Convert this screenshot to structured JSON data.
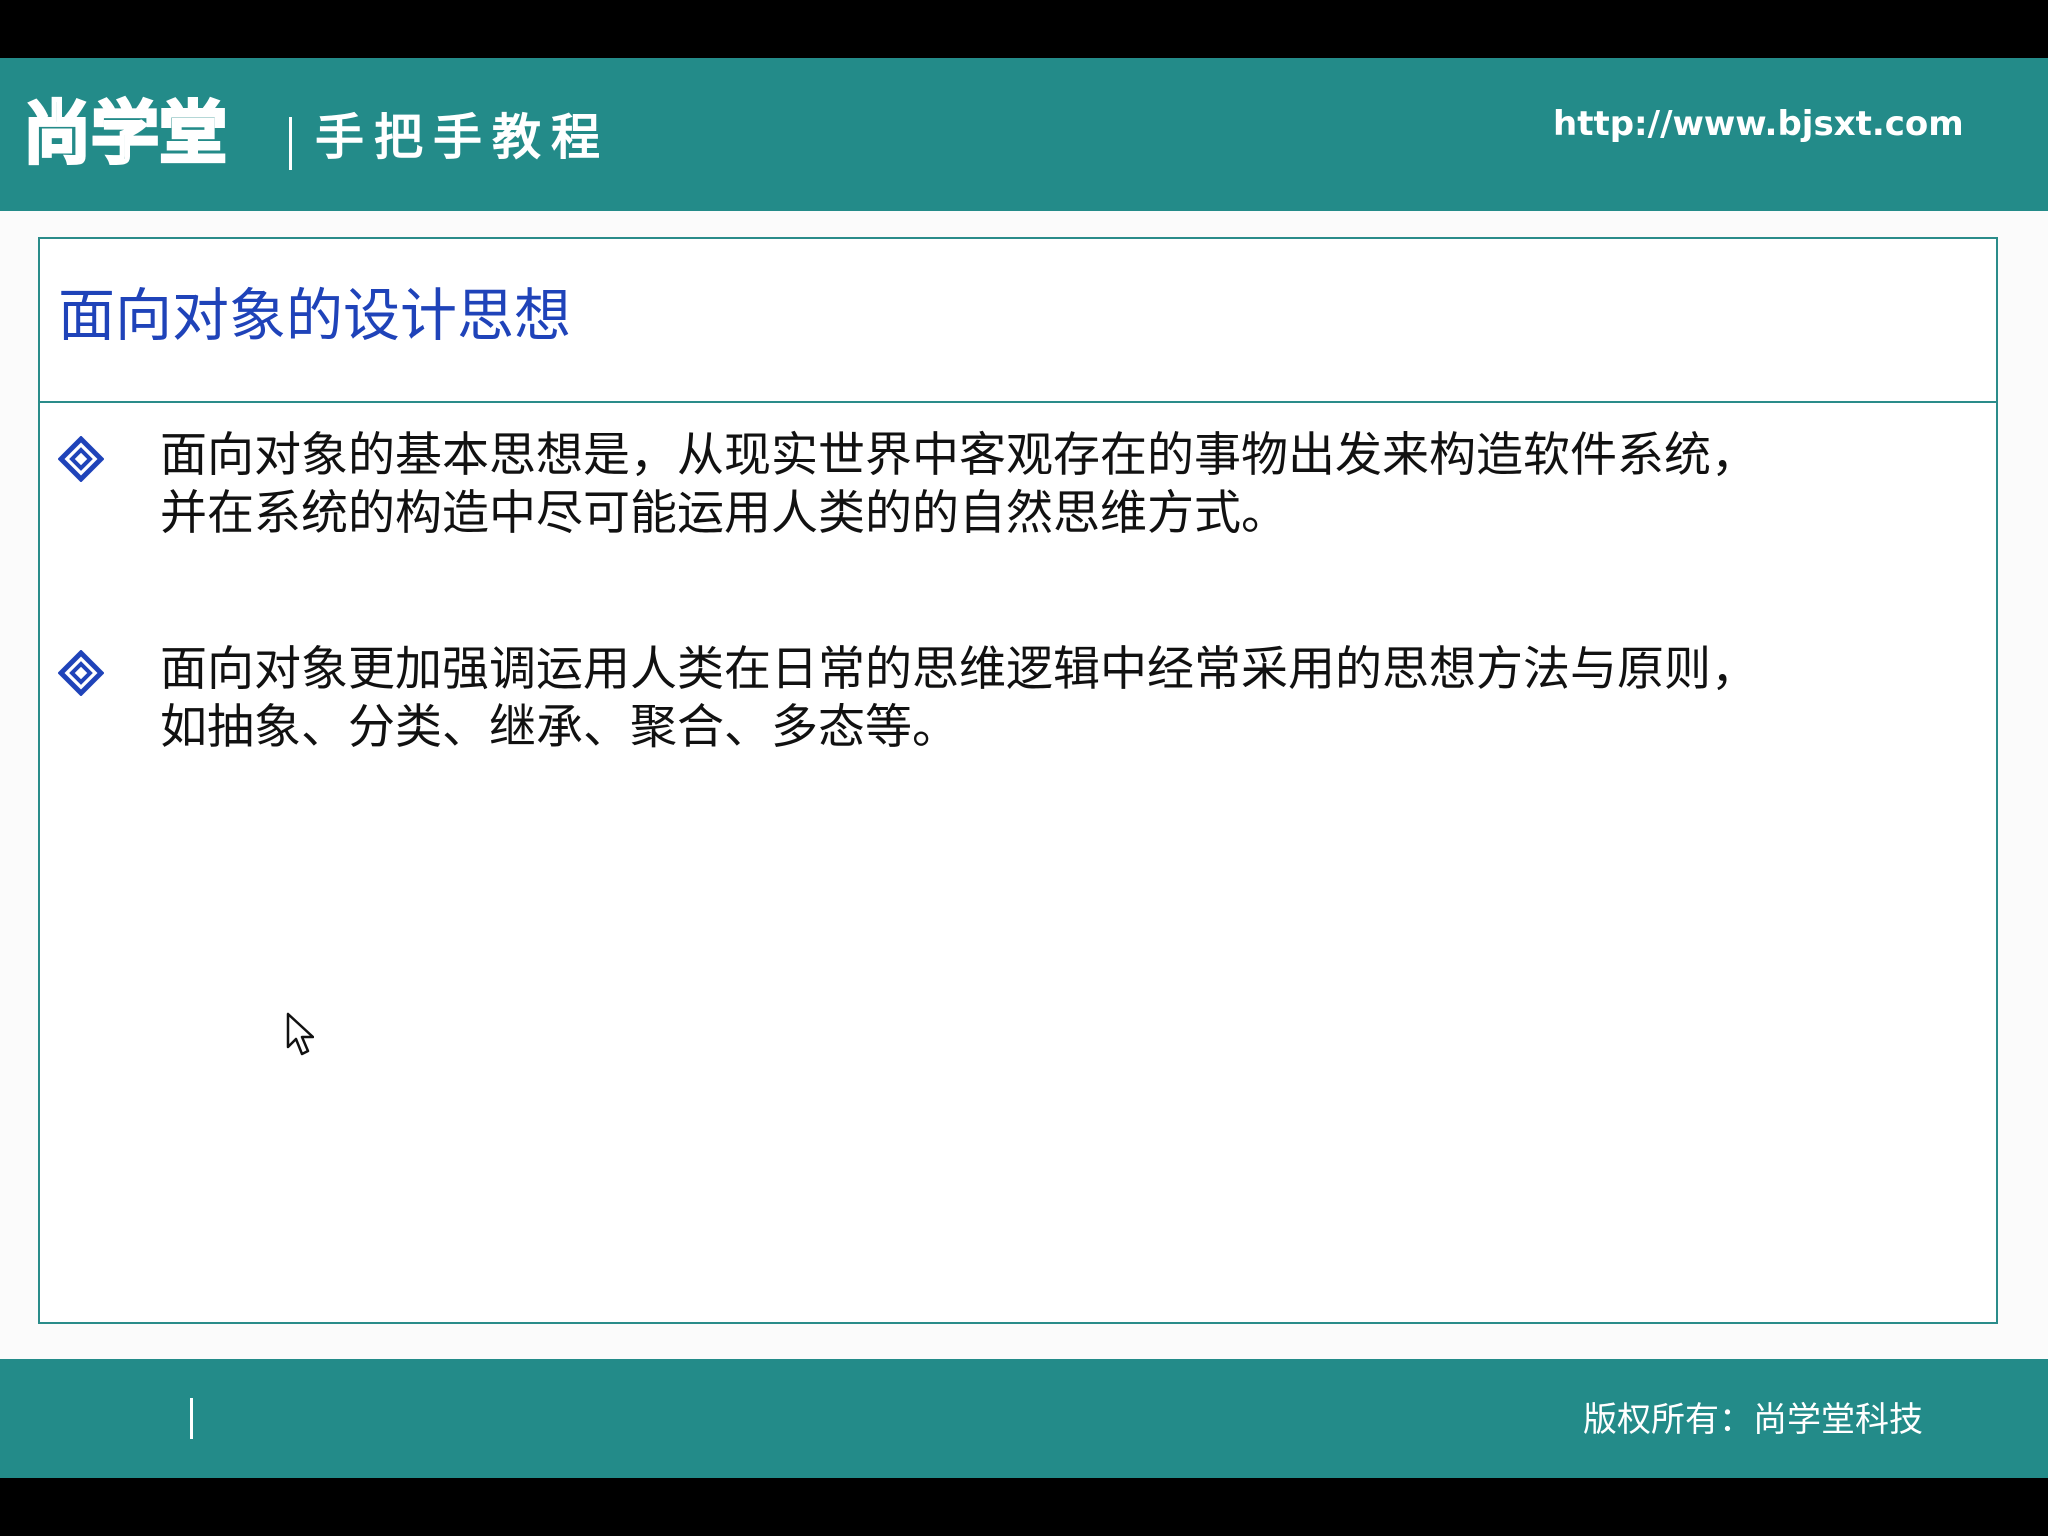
{
  "header": {
    "logo": "尚学堂",
    "tagline": "手把手教程",
    "url": "http://www.bjsxt.com"
  },
  "slide": {
    "title": "面向对象的设计思想",
    "bullets": [
      {
        "lines": [
          "面向对象的基本思想是，从现实世界中客观存在的事物出发来构造软件系统，",
          "并在系统的构造中尽可能运用人类的的自然思维方式。"
        ]
      },
      {
        "lines": [
          "面向对象更加强调运用人类在日常的思维逻辑中经常采用的思想方法与原则，",
          "如抽象、分类、继承、聚合、多态等。"
        ]
      }
    ]
  },
  "footer": {
    "copyright": "版权所有：尚学堂科技"
  },
  "icons": {
    "bullet": "diamond-bullet-icon",
    "cursor": "mouse-pointer-icon"
  },
  "colors": {
    "theme_teal": "#238b89",
    "title_blue": "#1f43b9",
    "bullet_blue": "#1f43b9",
    "text_black": "#111111"
  }
}
